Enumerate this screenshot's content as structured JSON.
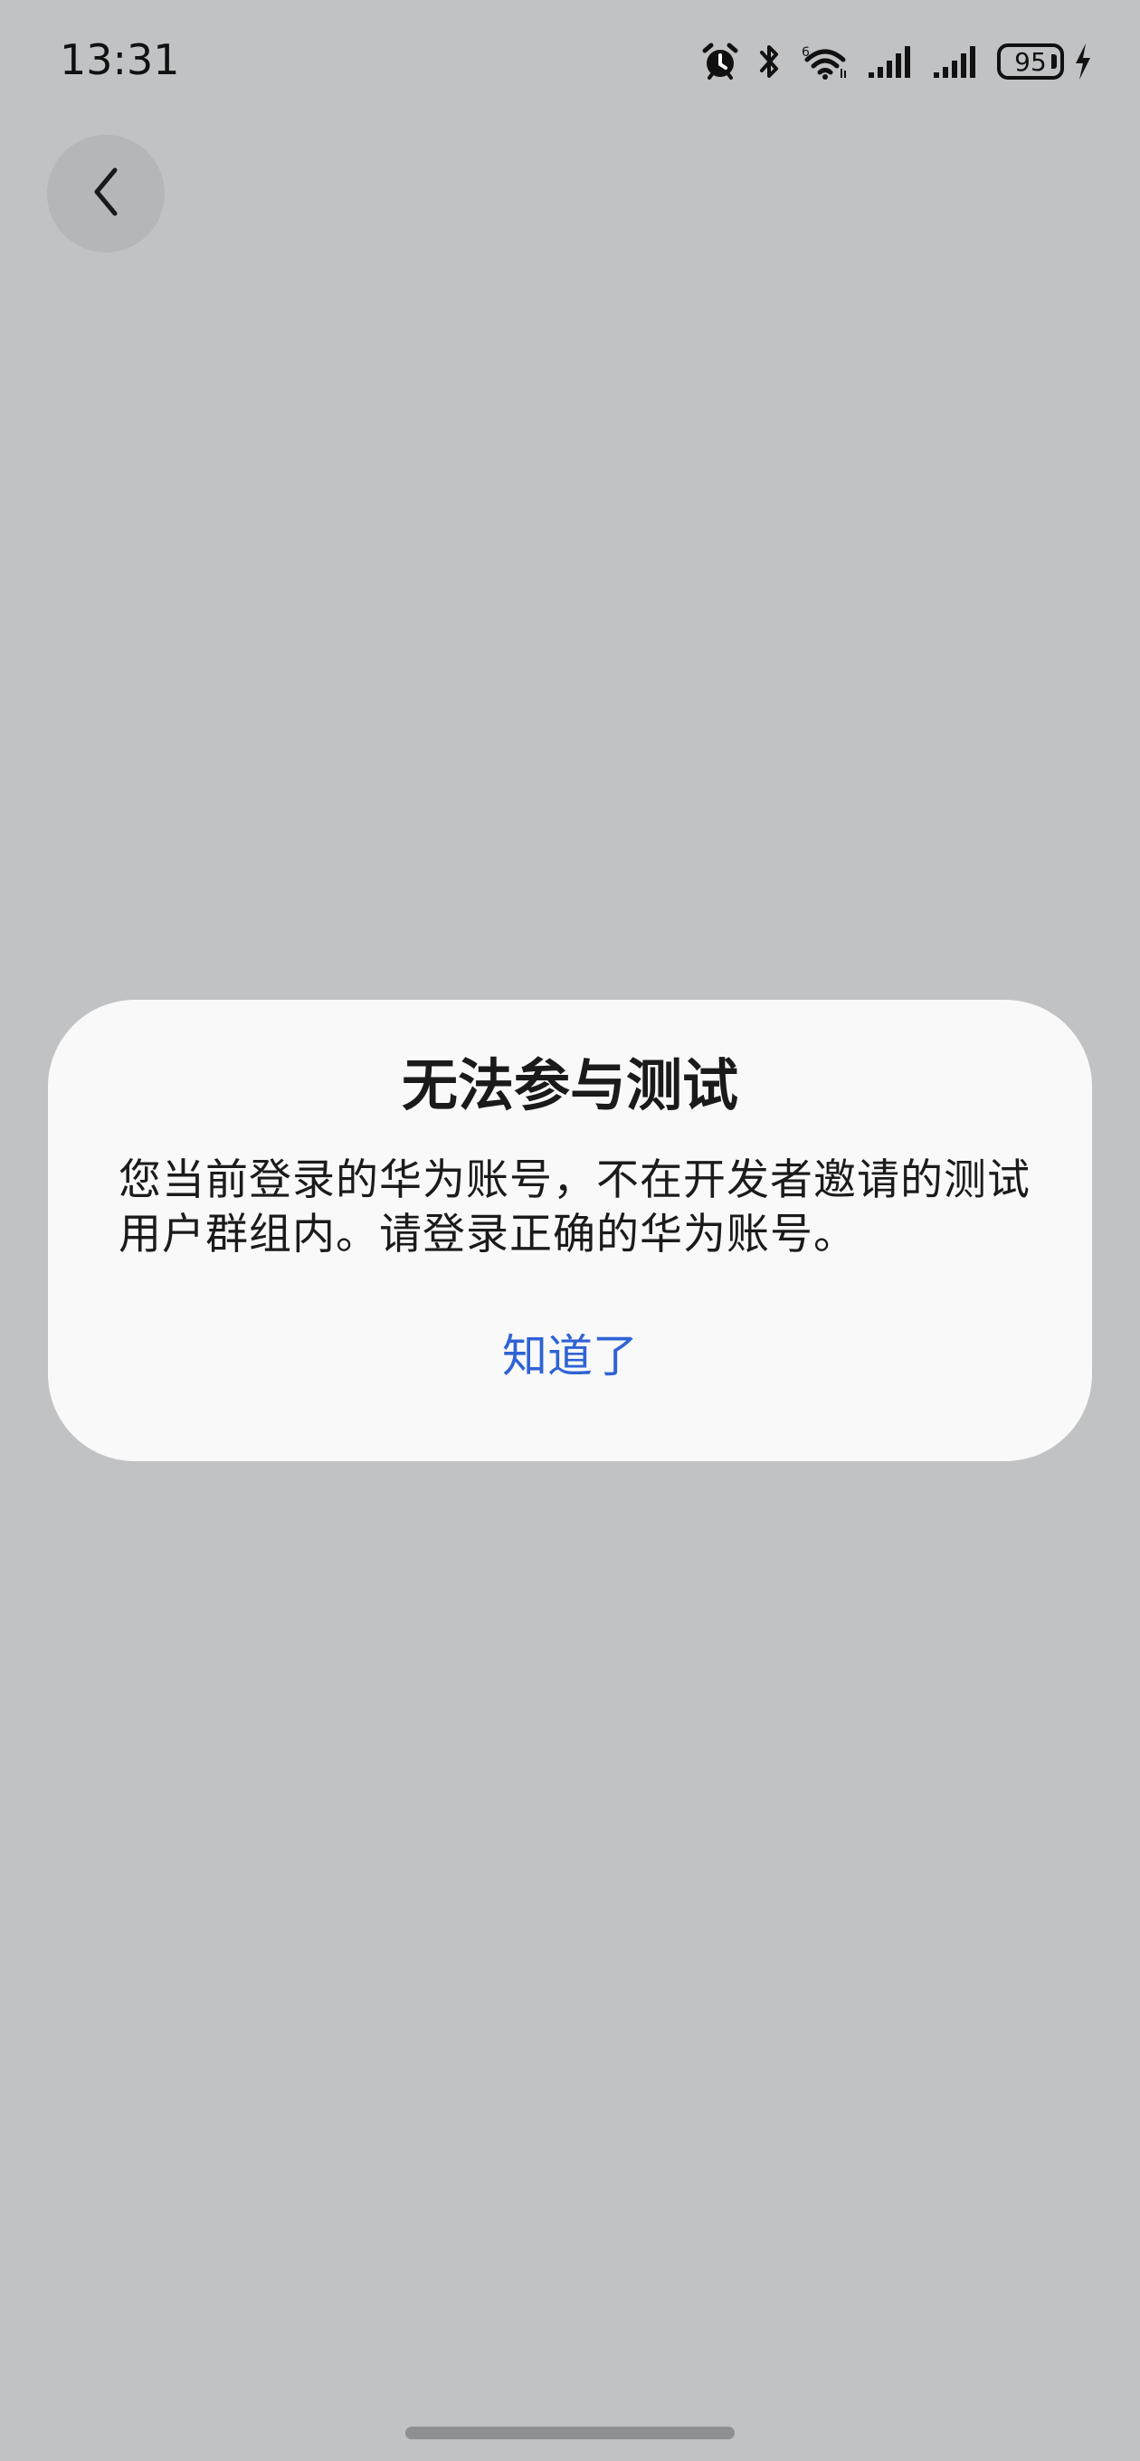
{
  "status_bar": {
    "time": "13:31",
    "battery_level": "95",
    "icons": [
      "alarm-icon",
      "bluetooth-icon",
      "wifi-6-icon",
      "signal-icon",
      "signal-icon",
      "battery-icon",
      "charging-icon"
    ]
  },
  "nav": {
    "back_icon": "chevron-left-icon"
  },
  "dialog": {
    "title": "无法参与测试",
    "message": "您当前登录的华为账号，不在开发者邀请的测试用户群组内。请登录正确的华为账号。",
    "confirm_label": "知道了"
  },
  "colors": {
    "background": "#c1c2c4",
    "dialog_background": "#f9f9f9",
    "accent": "#2f63d5"
  }
}
